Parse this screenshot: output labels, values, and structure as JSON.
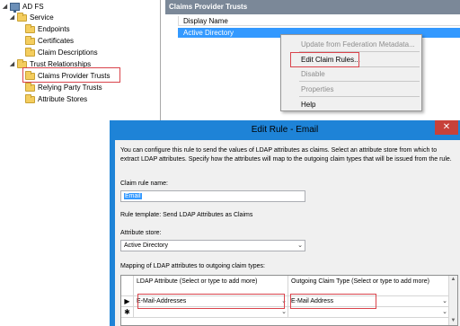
{
  "tree": {
    "root": "AD FS",
    "items": [
      {
        "label": "Service"
      },
      {
        "label": "Endpoints"
      },
      {
        "label": "Certificates"
      },
      {
        "label": "Claim Descriptions"
      },
      {
        "label": "Trust Relationships"
      },
      {
        "label": "Claims Provider Trusts"
      },
      {
        "label": "Relying Party Trusts"
      },
      {
        "label": "Attribute Stores"
      }
    ],
    "expand_open": "◢",
    "expand_closed": "▷"
  },
  "right_pane": {
    "header": "Claims Provider Trusts",
    "column": "Display Name",
    "row": "Active Directory"
  },
  "context_menu": {
    "items": [
      {
        "label": "Update from Federation Metadata...",
        "enabled": false
      },
      {
        "label": "Edit Claim Rules...",
        "enabled": true
      },
      {
        "label": "Disable",
        "enabled": false
      },
      {
        "label": "Properties",
        "enabled": false
      },
      {
        "label": "Help",
        "enabled": true
      }
    ]
  },
  "dialog": {
    "title": "Edit Rule - Email",
    "close": "✕",
    "description": "You can configure this rule to send the values of LDAP attributes as claims. Select an attribute store from which to extract LDAP attributes. Specify how the attributes will map to the outgoing claim types that will be issued from the rule.",
    "rule_name_label": "Claim rule name:",
    "rule_name_value": "Email",
    "rule_template": "Rule template: Send LDAP Attributes as Claims",
    "attribute_store_label": "Attribute store:",
    "attribute_store_value": "Active Directory",
    "mapping_label": "Mapping of LDAP attributes to outgoing claim types:",
    "grid": {
      "col1": "LDAP Attribute (Select or type to add more)",
      "col2": "Outgoing Claim Type (Select or type to add more)",
      "rows": [
        {
          "marker": "▶",
          "ldap": "E-Mail-Addresses",
          "claim": "E-Mail Address"
        },
        {
          "marker": "✱",
          "ldap": "",
          "claim": ""
        }
      ]
    },
    "dropdown_arrow": "⌄"
  },
  "colors": {
    "dialog_frame": "#1e83d7",
    "selection": "#3399ff",
    "highlight_box": "#d9434b",
    "pane_header": "#7b8898"
  }
}
